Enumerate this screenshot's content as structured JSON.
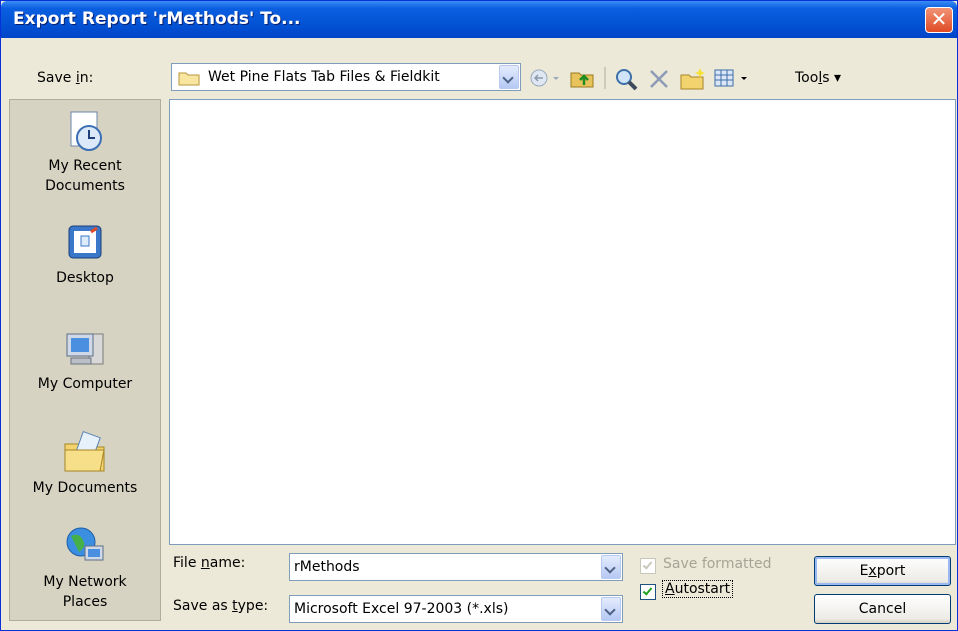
{
  "window": {
    "title": "Export Report 'rMethods' To..."
  },
  "toolbar": {
    "save_in_label": "Save in:",
    "location": "Wet Pine Flats Tab Files & Fieldkit",
    "tools_label": "Tools"
  },
  "places": [
    {
      "label_line1": "My Recent",
      "label_line2": "Documents",
      "icon": "recent-documents-icon"
    },
    {
      "label_line1": "Desktop",
      "label_line2": "",
      "icon": "desktop-icon"
    },
    {
      "label_line1": "My Computer",
      "label_line2": "",
      "icon": "my-computer-icon"
    },
    {
      "label_line1": "My Documents",
      "label_line2": "",
      "icon": "my-documents-icon"
    },
    {
      "label_line1": "My Network",
      "label_line2": "Places",
      "icon": "network-places-icon"
    }
  ],
  "form": {
    "file_name_label": "File name:",
    "file_name_value": "rMethods",
    "save_as_type_label": "Save as type:",
    "save_as_type_value": "Microsoft Excel 97-2003 (*.xls)",
    "save_formatted_label": "Save formatted",
    "save_formatted_checked": true,
    "save_formatted_enabled": false,
    "autostart_label": "Autostart",
    "autostart_checked": true
  },
  "buttons": {
    "export_label": "Export",
    "cancel_label": "Cancel"
  },
  "colors": {
    "titlebar": "#0453d5",
    "dialog_bg": "#ece9d8",
    "close_button": "#e04a24"
  }
}
